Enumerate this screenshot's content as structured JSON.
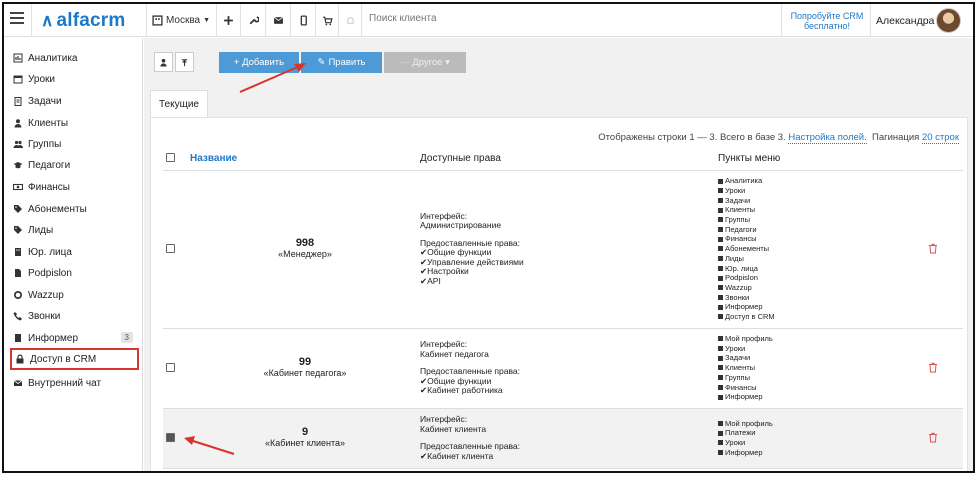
{
  "topbar": {
    "logo_mark": "∧",
    "logo_text": "alfacrm",
    "branch": "Москва",
    "search_placeholder": "Поиск клиента",
    "promo": "Попробуйте CRM бесплатно!",
    "user_name": "Александра"
  },
  "sidebar": {
    "items": [
      {
        "label": "Аналитика",
        "icon": "chart-icon"
      },
      {
        "label": "Уроки",
        "icon": "calendar-icon"
      },
      {
        "label": "Задачи",
        "icon": "clipboard-icon"
      },
      {
        "label": "Клиенты",
        "icon": "user-icon"
      },
      {
        "label": "Группы",
        "icon": "users-icon"
      },
      {
        "label": "Педагоги",
        "icon": "graduation-cap-icon"
      },
      {
        "label": "Финансы",
        "icon": "money-icon"
      },
      {
        "label": "Абонементы",
        "icon": "tag-icon"
      },
      {
        "label": "Лиды",
        "icon": "tag-icon"
      },
      {
        "label": "Юр. лица",
        "icon": "building-icon"
      },
      {
        "label": "Podpislon",
        "icon": "document-icon"
      },
      {
        "label": "Wazzup",
        "icon": "whatsapp-icon"
      },
      {
        "label": "Звонки",
        "icon": "phone-icon"
      },
      {
        "label": "Информер",
        "icon": "document-icon",
        "badge": "3"
      },
      {
        "label": "Доступ в CRM",
        "icon": "lock-icon"
      },
      {
        "label": "Внутренний чат",
        "icon": "mail-icon"
      }
    ]
  },
  "toolbar": {
    "add_label": "+ Добавить",
    "edit_label": "Править",
    "other_label": "··· Другое ▾"
  },
  "tabs": {
    "current": "Текущие"
  },
  "info": {
    "text": "Отображены строки 1 — 3. Всего в базе 3.",
    "settings_link": "Настройка полей.",
    "pagination_label": "Пагинация",
    "pagination_value": "20 строк"
  },
  "table": {
    "headers": {
      "name": "Название",
      "rights": "Доступные права",
      "menu": "Пункты меню"
    },
    "rows": [
      {
        "id": "998",
        "name": "«Менеджер»",
        "checked": false,
        "interface_label": "Интерфейс:",
        "interface": "Администрирование",
        "rights_label": "Предоставленные права:",
        "rights": [
          "✔Общие функции",
          "✔Управление действиями",
          "✔Настройки",
          "✔API"
        ],
        "menu": [
          "Аналитика",
          "Уроки",
          "Задачи",
          "Клиенты",
          "Группы",
          "Педагоги",
          "Финансы",
          "Абонементы",
          "Лиды",
          "Юр. лица",
          "Podpislon",
          "Wazzup",
          "Звонки",
          "Информер",
          "Доступ в CRM"
        ]
      },
      {
        "id": "99",
        "name": "«Кабинет педагога»",
        "checked": false,
        "interface_label": "Интерфейс:",
        "interface": "Кабинет педагога",
        "rights_label": "Предоставленные права:",
        "rights": [
          "✔Общие функции",
          "✔Кабинет работника"
        ],
        "menu": [
          "Мой профиль",
          "Уроки",
          "Задачи",
          "Клиенты",
          "Группы",
          "Финансы",
          "Информер"
        ]
      },
      {
        "id": "9",
        "name": "«Кабинет клиента»",
        "checked": true,
        "interface_label": "Интерфейс:",
        "interface": "Кабинет клиента",
        "rights_label": "Предоставленные права:",
        "rights": [
          "✔Кабинет клиента"
        ],
        "menu": [
          "Мой профиль",
          "Платежи",
          "Уроки",
          "Информер"
        ]
      }
    ]
  },
  "colors": {
    "accent": "#1e78c8",
    "button": "#4d9ad6",
    "highlight": "#d9342b",
    "delete": "#d9534f"
  }
}
